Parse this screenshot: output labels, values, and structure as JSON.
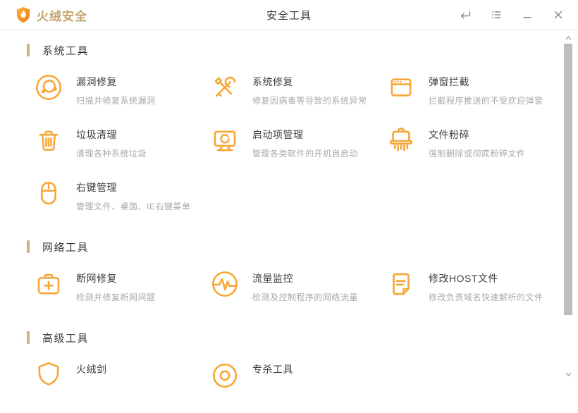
{
  "window": {
    "app_name": "火绒安全",
    "title": "安全工具",
    "controls": [
      {
        "label": "back",
        "icon": "back-arrow-icon"
      },
      {
        "label": "menu",
        "icon": "list-menu-icon"
      },
      {
        "label": "minimize",
        "icon": "minimize-icon"
      },
      {
        "label": "close",
        "icon": "close-icon"
      }
    ]
  },
  "colors": {
    "accent_orange": "#F7A738",
    "brand_gold": "#C5A369",
    "section_bar_tan": "#CDB286",
    "title_text": "#3E3E3E",
    "desc_text": "#A9A9A9",
    "scrollbar_thumb": "#BDBDBD"
  },
  "sections": [
    {
      "title": "系统工具",
      "tools": [
        {
          "icon": "vulnerability-fix-icon",
          "name": "漏洞修复",
          "desc": "扫描并修复系统漏洞"
        },
        {
          "icon": "system-repair-icon",
          "name": "系统修复",
          "desc": "修复因病毒等导致的系统异常"
        },
        {
          "icon": "popup-blocker-icon",
          "name": "弹窗拦截",
          "desc": "拦截程序推送的不受欢迎弹窗"
        },
        {
          "icon": "junk-clean-icon",
          "name": "垃圾清理",
          "desc": "清理各种系统垃圾"
        },
        {
          "icon": "startup-manager-icon",
          "name": "启动项管理",
          "desc": "管理各类软件的开机自启动"
        },
        {
          "icon": "file-shredder-icon",
          "name": "文件粉碎",
          "desc": "强制删除或彻底粉碎文件"
        },
        {
          "icon": "right-click-manager-icon",
          "name": "右键管理",
          "desc": "管理文件、桌面、IE右键菜单"
        }
      ]
    },
    {
      "title": "网络工具",
      "tools": [
        {
          "icon": "network-repair-icon",
          "name": "断网修复",
          "desc": "检测并修复断网问题"
        },
        {
          "icon": "traffic-monitor-icon",
          "name": "流量监控",
          "desc": "检测及控制程序的网络流量"
        },
        {
          "icon": "host-file-icon",
          "name": "修改HOST文件",
          "desc": "修改负责域名快速解析的文件"
        }
      ]
    },
    {
      "title": "高级工具",
      "tools": [
        {
          "icon": "hrsword-icon",
          "name": "火绒剑",
          "desc": ""
        },
        {
          "icon": "special-kill-icon",
          "name": "专杀工具",
          "desc": ""
        }
      ]
    }
  ]
}
